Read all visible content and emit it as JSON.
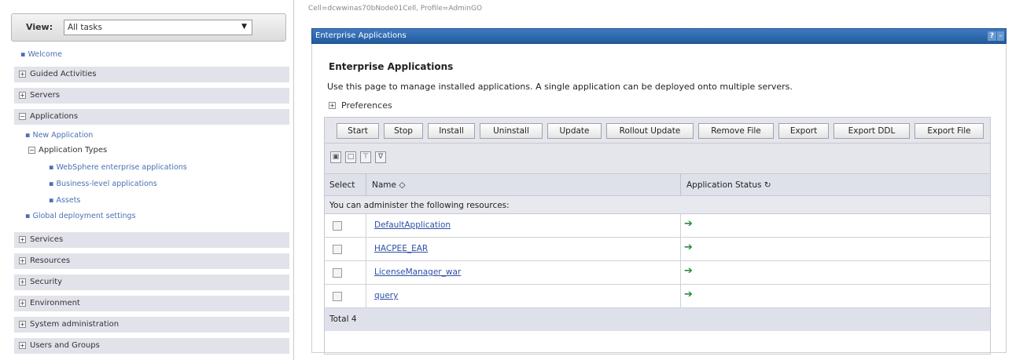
{
  "nav": {
    "view_label": "View:",
    "view_value": "All tasks",
    "welcome": "Welcome",
    "sections_top": [
      {
        "label": "Guided Activities",
        "toggle": "+"
      },
      {
        "label": "Servers",
        "toggle": "+"
      },
      {
        "label": "Applications",
        "toggle": "−"
      }
    ],
    "app_children": {
      "new_application": "New Application",
      "app_types_label": "Application Types",
      "app_types_toggle": "−",
      "websphere_enterprise": "WebSphere enterprise applications",
      "business_level": "Business-level applications",
      "assets": "Assets",
      "global_deployment": "Global deployment settings"
    },
    "sections_bottom": [
      {
        "label": "Services",
        "toggle": "+"
      },
      {
        "label": "Resources",
        "toggle": "+"
      },
      {
        "label": "Security",
        "toggle": "+"
      },
      {
        "label": "Environment",
        "toggle": "+"
      },
      {
        "label": "System administration",
        "toggle": "+"
      },
      {
        "label": "Users and Groups",
        "toggle": "+"
      }
    ]
  },
  "breadcrumb": "Cell=dcwwinas70bNode01Cell, Profile=AdminGO",
  "portlet": {
    "title": "Enterprise Applications",
    "help": "?",
    "close": "–"
  },
  "main": {
    "heading": "Enterprise Applications",
    "description": "Use this page to manage installed applications. A single application can be deployed onto multiple servers.",
    "preferences_label": "Preferences",
    "preferences_toggle": "+",
    "buttons": [
      "Start",
      "Stop",
      "Install",
      "Uninstall",
      "Update",
      "Rollout Update",
      "Remove File",
      "Export",
      "Export DDL",
      "Export File"
    ],
    "icon_buttons": [
      "select-all-icon",
      "deselect-all-icon",
      "show-filter-icon",
      "clear-filter-icon"
    ]
  },
  "table": {
    "col_select": "Select",
    "col_name": "Name ◇",
    "col_status": "Application Status ↻",
    "info": "You can administer the following resources:",
    "rows": [
      {
        "name": "DefaultApplication",
        "status": "started"
      },
      {
        "name": "HACPEE_EAR",
        "status": "started"
      },
      {
        "name": "LicenseManager_war",
        "status": "started"
      },
      {
        "name": "query",
        "status": "started"
      }
    ],
    "status_glyph": "➔",
    "total": "Total 4"
  },
  "colors": {
    "title_bar": "#225b9c",
    "link": "#2c4fa6",
    "status_started": "#2b8a3e"
  }
}
